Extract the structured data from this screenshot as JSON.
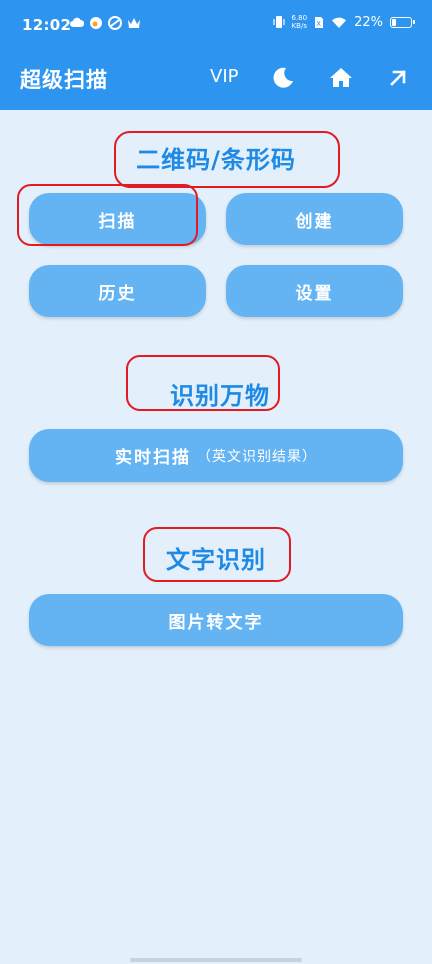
{
  "status_bar": {
    "time": "12:02",
    "net_speed_value": "6.80",
    "net_speed_unit": "KB/s",
    "battery": "22%",
    "battery_level": 0.22
  },
  "appbar": {
    "title": "超级扫描",
    "vip_label": "VIP",
    "icons": [
      "moon-icon",
      "home-icon",
      "arrow-up-right-icon"
    ]
  },
  "sections": {
    "barcode": {
      "title": "二维码/条形码",
      "buttons": {
        "scan": "扫描",
        "create": "创建",
        "history": "历史",
        "settings": "设置"
      }
    },
    "recognize": {
      "title": "识别万物",
      "realtime_label": "实时扫描",
      "realtime_note": "（英文识别结果）"
    },
    "ocr": {
      "title": "文字识别",
      "image_to_text": "图片转文字"
    }
  },
  "colors": {
    "appbar": "#2d95f0",
    "background": "#e3f0fb",
    "button": "#64b4f4",
    "section_title": "#1f8ae6",
    "annotation": "#e21b23"
  }
}
